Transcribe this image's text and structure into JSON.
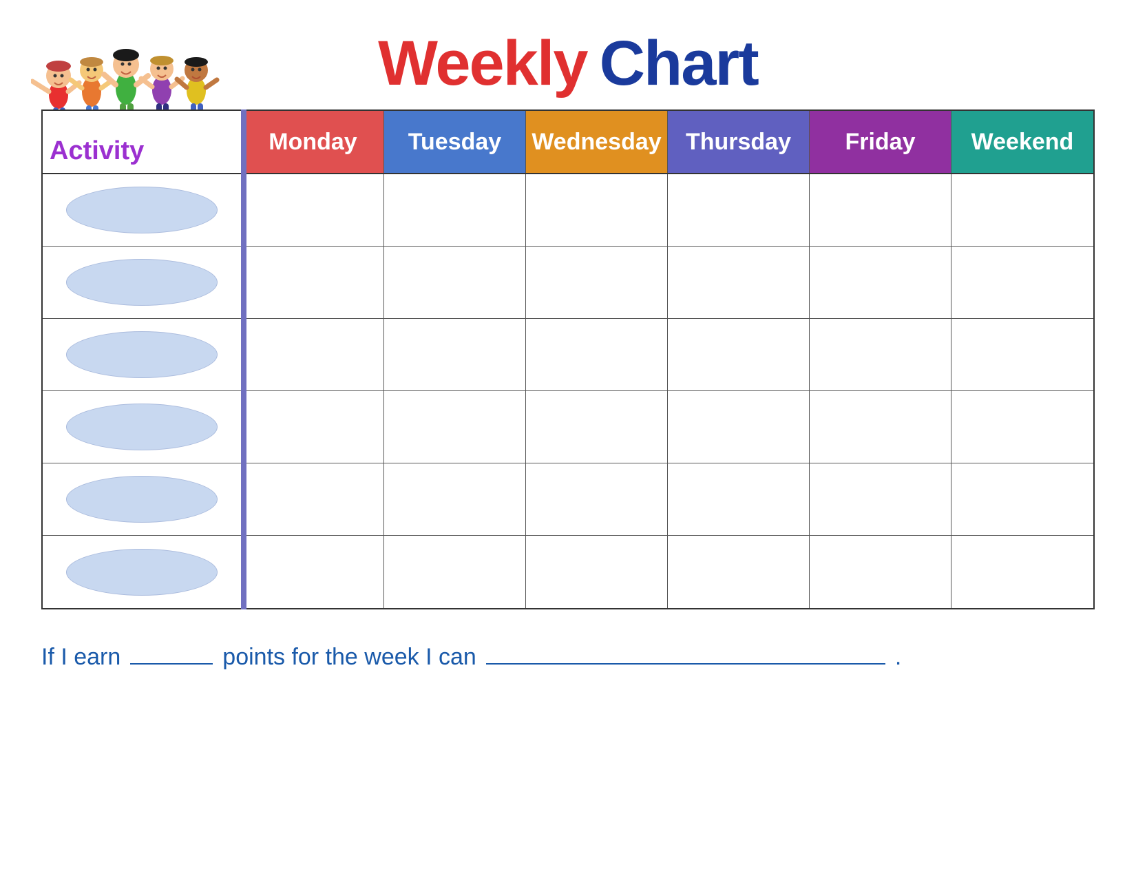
{
  "title": {
    "weekly": "Weekly",
    "chart": "Chart"
  },
  "activity_label": "Activity",
  "days": [
    {
      "label": "Monday",
      "class": "monday"
    },
    {
      "label": "Tuesday",
      "class": "tuesday"
    },
    {
      "label": "Wednesday",
      "class": "wednesday"
    },
    {
      "label": "Thursday",
      "class": "thursday"
    },
    {
      "label": "Friday",
      "class": "friday"
    },
    {
      "label": "Weekend",
      "class": "weekend"
    }
  ],
  "rows": 6,
  "footer": {
    "prefix": "If I earn",
    "middle": "points for the week I can",
    "suffix": "."
  },
  "colors": {
    "monday": "#e05050",
    "tuesday": "#4878cc",
    "wednesday": "#e09020",
    "thursday": "#6060c0",
    "friday": "#9030a0",
    "weekend": "#20a090",
    "activity_text": "#9b30d0",
    "title_weekly": "#e03030",
    "title_chart": "#1a3a9c"
  }
}
